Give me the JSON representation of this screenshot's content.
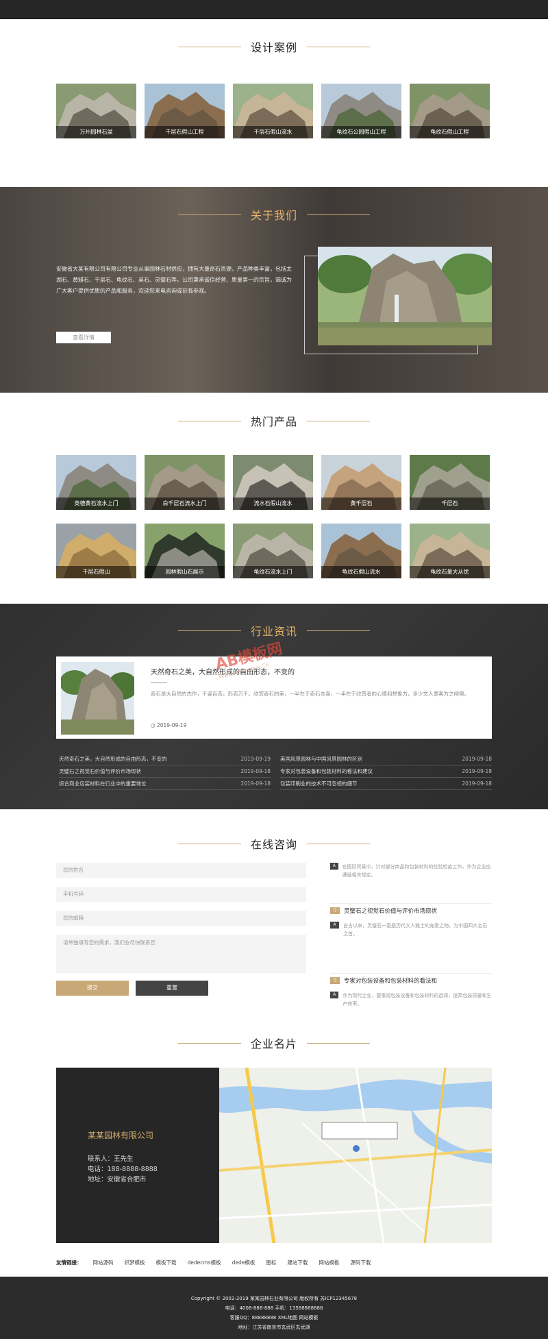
{
  "sections": {
    "cases": "设计案例",
    "about": "关于我们",
    "products": "热门产品",
    "news": "行业资讯",
    "consult": "在线咨询",
    "card": "企业名片"
  },
  "cases": [
    {
      "caption": "万州园林石盆"
    },
    {
      "caption": "千层石假山工程"
    },
    {
      "caption": "千层石假山流水"
    },
    {
      "caption": "龟纹石公园假山工程"
    },
    {
      "caption": "龟纹石假山工程"
    }
  ],
  "about": {
    "text": "安徽省大某有限公司有限公司专业从事园林石材供应，拥有大量奇石资源，产品种类丰富，包括太湖石、黄蜡石、千层石、龟纹石、英石、灵璧石等。公司秉承诚信经营、质量第一的宗旨，竭诚为广大客户提供优质的产品和服务，欢迎您来电咨询或莅临参观。",
    "more": "查看详情"
  },
  "products": [
    {
      "caption": "英德黄石流水上门"
    },
    {
      "caption": "白千层石流水上门"
    },
    {
      "caption": "流水石假山流水"
    },
    {
      "caption": "黄千层石"
    },
    {
      "caption": "千层石"
    },
    {
      "caption": "千层石假山"
    },
    {
      "caption": "园林假山石展示"
    },
    {
      "caption": "龟纹石流水上门"
    },
    {
      "caption": "龟纹石假山流水"
    },
    {
      "caption": "龟纹石量大从优"
    }
  ],
  "news": {
    "feature": {
      "title": "天然奇石之美，大自然形成的自由形态，不变的",
      "desc": "奇石是大自然的杰作，千姿百态，形态万千。欣赏奇石的美，一半在于奇石本身，一半在于欣赏者的心境和想象力，多少文人墨客为之倾倒。",
      "date": "2019-09-19"
    },
    "list": [
      {
        "title": "天然奇石之美，大自然形成的自由形态，不变的",
        "date": "2019-09-19"
      },
      {
        "title": "英国风景园林与中国风景园林的区别",
        "date": "2019-09-18"
      },
      {
        "title": "灵璧石之视觉石价值与评价市场现状",
        "date": "2019-09-18"
      },
      {
        "title": "专家对包装设备和包装材料的看法和建议",
        "date": "2019-09-18"
      },
      {
        "title": "综合商业包装材料在行业中的重要地位",
        "date": "2019-09-18"
      },
      {
        "title": "包装印刷业的技术不可忽视的细节",
        "date": "2019-09-18"
      }
    ]
  },
  "form": {
    "name": "您的姓名",
    "phone": "手机号码",
    "email": "您的邮箱",
    "message": "请单独填写您的需求，我们会尽快联系您",
    "submit": "提交",
    "reset": "重置"
  },
  "faq": [
    {
      "q": "",
      "a": "在国际贸易中，针对部分商品和包装材料的检验检疫工作，作为企业应遵循相关规定。"
    },
    {
      "q": "灵璧石之视觉石价值与评价市场现状",
      "a": "自古以来，灵璧石一直是历代文人雅士的宠爱之物，为中国四大名石之首。"
    },
    {
      "q": "专家对包装设备和包装材料的看法和",
      "a": "作为现代企业，要重视包装设备和包装材料的选择，提高包装质量和生产效率。"
    }
  ],
  "biz": {
    "company": "某某园林有限公司",
    "contact": "联系人：王先生",
    "phone": "电话：188-8888-8888",
    "address": "地址：安徽省合肥市"
  },
  "links": {
    "label": "友情链接：",
    "items": [
      "网站源码",
      "织梦模板",
      "模板下载",
      "dedecms模板",
      "dede模板",
      "图标",
      "建站下载",
      "网站模板",
      "源码下载"
    ]
  },
  "footer": {
    "line1": "Copyright © 2002-2019 某某园林石业有限公司 版权所有 苏ICP12345678",
    "line2": "电话：4008-888-888 手机：13588888888",
    "line3": "客服QQ：88888888  XML地图  网站模板",
    "line4": "地址：江苏省南京市玄武区玄武湖"
  },
  "watermark": {
    "main": "AB模板网",
    "sub": "Www.Adminbuy.Cn"
  }
}
